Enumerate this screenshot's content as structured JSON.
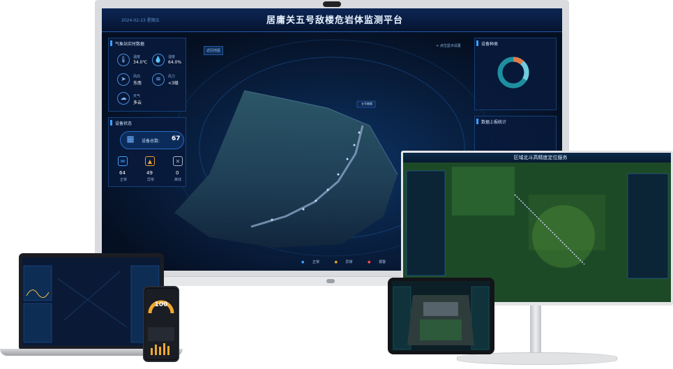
{
  "main_screen": {
    "title": "居庸关五号敌楼危岩体监测平台",
    "date": "2024-02-23  星期五",
    "weather_panel": {
      "title": "气象站实时数据",
      "items": [
        {
          "label": "温度",
          "value": "34.0℃",
          "icon": "thermometer-icon"
        },
        {
          "label": "湿度",
          "value": "64.0%",
          "icon": "humidity-icon"
        },
        {
          "label": "风向",
          "value": "东南",
          "icon": "wind-direction-icon"
        },
        {
          "label": "风力",
          "value": "<3级",
          "icon": "wind-speed-icon"
        },
        {
          "label": "天气",
          "value": "多云",
          "icon": "cloud-icon"
        }
      ]
    },
    "device_panel": {
      "title": "设备状态",
      "total_label": "设备总数:",
      "total_value": "67",
      "normal_value": "64",
      "normal_label": "正常",
      "abnormal_value": "49",
      "abnormal_label": "异常",
      "offline_value": "0",
      "offline_label": "离线"
    },
    "device_types_panel": {
      "title": "设备种类"
    },
    "data_stats_panel": {
      "title": "数据上报统计"
    },
    "map_tag": "五号敌楼",
    "top_label": "返回地图",
    "top_right_label": "+ 点位显示设置",
    "legend": [
      "正常",
      "异常",
      "报警",
      "离线"
    ]
  },
  "monitor": {
    "title": "区域北斗高精度定位服务"
  },
  "phone": {
    "gauge_value": "100"
  },
  "colors": {
    "accent": "#3aa0ff",
    "normal": "#3aa0ff",
    "warning": "#f0a030",
    "alarm": "#ff4a4a",
    "offline": "#9aa0a6"
  }
}
